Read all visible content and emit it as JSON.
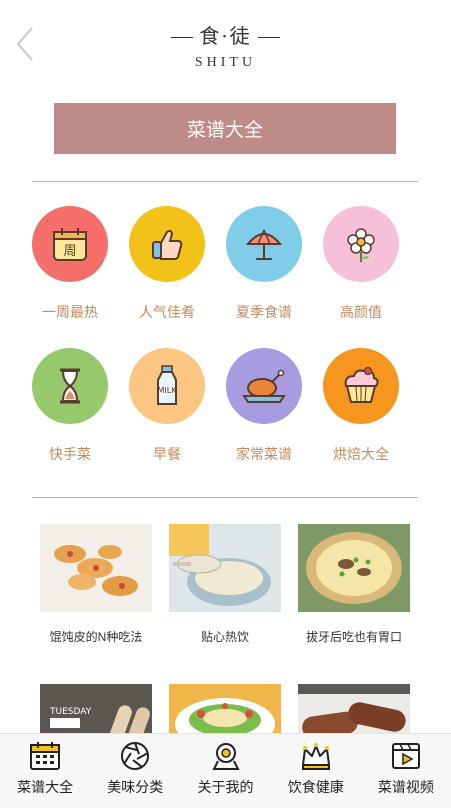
{
  "header": {
    "logo_cn_1": "食",
    "logo_cn_sep": "·",
    "logo_cn_2": "徒",
    "logo_en": "SHITU",
    "title": "菜谱大全"
  },
  "categories": [
    {
      "label": "一周最热",
      "icon": "calendar-icon",
      "icon_text": "周",
      "color": "#f46f6a"
    },
    {
      "label": "人气佳肴",
      "icon": "thumbs-up-icon",
      "color": "#f3c219"
    },
    {
      "label": "夏季食谱",
      "icon": "umbrella-icon",
      "color": "#7fcde8"
    },
    {
      "label": "高颜值",
      "icon": "flower-icon",
      "color": "#f6c0d8"
    },
    {
      "label": "快手菜",
      "icon": "hourglass-icon",
      "color": "#96c86c"
    },
    {
      "label": "早餐",
      "icon": "milk-bottle-icon",
      "icon_text": "MILK",
      "color": "#fbc682"
    },
    {
      "label": "家常菜谱",
      "icon": "roast-chicken-icon",
      "color": "#a89be0"
    },
    {
      "label": "烘焙大全",
      "icon": "cupcake-icon",
      "color": "#f7961f"
    }
  ],
  "recipes": [
    {
      "caption": "馄饨皮的N种吃法"
    },
    {
      "caption": "贴心热饮"
    },
    {
      "caption": "拔牙后吃也有胃口"
    },
    {
      "caption": "",
      "photo_text": "TUESDAY"
    },
    {
      "caption": ""
    },
    {
      "caption": ""
    }
  ],
  "tabbar": [
    {
      "label": "菜谱大全",
      "icon": "calendar-grid-icon"
    },
    {
      "label": "美味分类",
      "icon": "aperture-icon"
    },
    {
      "label": "关于我的",
      "icon": "user-pin-icon"
    },
    {
      "label": "饮食健康",
      "icon": "crown-icon"
    },
    {
      "label": "菜谱视频",
      "icon": "video-icon"
    }
  ]
}
